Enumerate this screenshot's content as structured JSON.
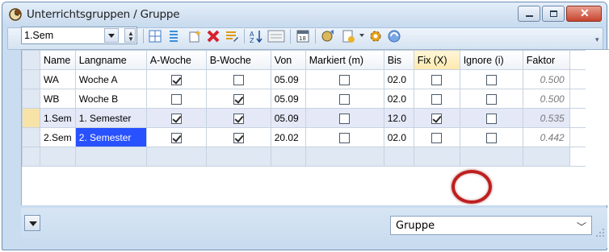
{
  "window": {
    "title": "Unterrichtsgruppen / Gruppe",
    "app_icon": "clock-icon",
    "buttons": [
      "minimize-icon",
      "maximize-icon",
      "close-icon"
    ]
  },
  "toolbar": {
    "selector_value": "1.Sem",
    "icons": [
      "grid-icon",
      "columns-icon",
      "new-icon",
      "delete-icon",
      "edit-icon",
      "sort-icon",
      "field-icon",
      "calendar-icon",
      "settings-icon",
      "print-icon",
      "gear-icon",
      "refresh-icon"
    ]
  },
  "table": {
    "columns": [
      "Name",
      "Langname",
      "A-Woche",
      "B-Woche",
      "Von",
      "Markiert (m)",
      "Bis",
      "Fix (X)",
      "Ignore (i)",
      "Faktor"
    ],
    "rows": [
      {
        "name": "WA",
        "langname": "Woche A",
        "a_woche": true,
        "b_woche": false,
        "von": "05.09",
        "markiert": false,
        "bis": "02.0",
        "fix": false,
        "ignore": false,
        "faktor": "0.500"
      },
      {
        "name": "WB",
        "langname": "Woche B",
        "a_woche": false,
        "b_woche": true,
        "von": "05.09",
        "markiert": false,
        "bis": "02.0",
        "fix": false,
        "ignore": false,
        "faktor": "0.500"
      },
      {
        "name": "1.Sem",
        "langname": "1. Semester",
        "a_woche": true,
        "b_woche": true,
        "von": "05.09",
        "markiert": false,
        "bis": "12.0",
        "fix": true,
        "ignore": false,
        "faktor": "0.535"
      },
      {
        "name": "2.Sem",
        "langname": "2. Semester",
        "a_woche": true,
        "b_woche": true,
        "von": "20.02",
        "markiert": false,
        "bis": "02.0",
        "fix": false,
        "ignore": false,
        "faktor": "0.442"
      }
    ],
    "selected_row": 2,
    "highlighted_column": "Fix (X)"
  },
  "footer": {
    "view_select": "Gruppe"
  },
  "colors": {
    "title_bar": "#c8daee",
    "selection": "#2851ff",
    "highlight_ring": "#bf1f1f",
    "highlight_header": "#fde9ae"
  }
}
